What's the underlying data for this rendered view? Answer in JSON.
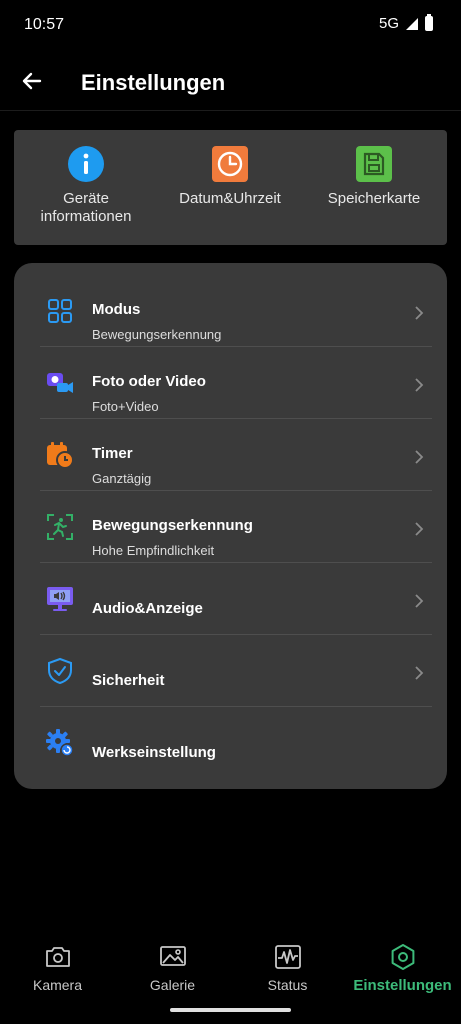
{
  "status_bar": {
    "time": "10:57",
    "network": "5G"
  },
  "header": {
    "title": "Einstellungen"
  },
  "quick": [
    {
      "label": "Geräte\ninformationen",
      "icon": "info-icon",
      "color": "#1e9bf0"
    },
    {
      "label": "Datum&Uhrzeit",
      "icon": "clock-icon",
      "color": "#f07b3c"
    },
    {
      "label": "Speicherkarte",
      "icon": "sd-card-icon",
      "color": "#5cc04a"
    }
  ],
  "settings": [
    {
      "title": "Modus",
      "subtitle": "Bewegungserkennung",
      "icon": "grid-icon"
    },
    {
      "title": "Foto oder Video",
      "subtitle": "Foto+Video",
      "icon": "camera-video-icon"
    },
    {
      "title": "Timer",
      "subtitle": "Ganztägig",
      "icon": "calendar-timer-icon"
    },
    {
      "title": "Bewegungserkennung",
      "subtitle": "Hohe Empfindlichkeit",
      "icon": "motion-scan-icon"
    },
    {
      "title": "Audio&Anzeige",
      "subtitle": "",
      "icon": "monitor-audio-icon"
    },
    {
      "title": "Sicherheit",
      "subtitle": "",
      "icon": "shield-icon"
    },
    {
      "title": "Werkseinstellung",
      "subtitle": "",
      "icon": "gear-reset-icon"
    }
  ],
  "nav": [
    {
      "label": "Kamera",
      "icon": "camera-icon"
    },
    {
      "label": "Galerie",
      "icon": "gallery-icon"
    },
    {
      "label": "Status",
      "icon": "waveform-icon"
    },
    {
      "label": "Einstellungen",
      "icon": "hexagon-settings-icon",
      "active": true
    }
  ],
  "colors": {
    "accent": "#3dbb7a",
    "card": "#3a3a3a",
    "background": "#000000"
  }
}
